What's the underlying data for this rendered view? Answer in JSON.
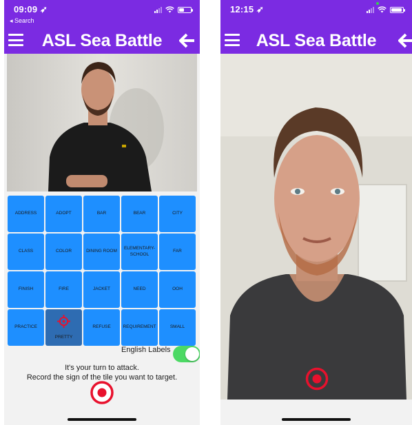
{
  "left": {
    "status": {
      "time": "09:09 ➶",
      "back_label": "◂ Search"
    },
    "nav": {
      "title": "ASL Sea Battle"
    },
    "tiles": [
      "ADDRESS",
      "ADOPT",
      "BAR",
      "BEAR",
      "CITY",
      "CLASS",
      "COLOR",
      "DINING ROOM",
      "ELEMENTARY-SCHOOL",
      "FAR",
      "FINISH",
      "FIRE",
      "JACKET",
      "NEED",
      "OOH",
      "PRACTICE",
      "PRETTY",
      "REFUSE",
      "REQUIREMENT",
      "SMALL"
    ],
    "targeted_tile": "PRETTY",
    "english_labels": {
      "label": "English Labels",
      "enabled": true
    },
    "message_line1": "It's your turn to attack.",
    "message_line2": "Record the sign of the tile you want to target."
  },
  "right": {
    "status": {
      "time": "12:15 ➶"
    },
    "nav": {
      "title": "ASL Sea Battle"
    }
  },
  "colors": {
    "purple": "#7b2be2",
    "tile_blue": "#1e8fff",
    "target_red": "#e8112d",
    "toggle_green": "#4cd964"
  },
  "icons": [
    "menu-icon",
    "back-arrow-icon",
    "crosshair-icon",
    "target-icon",
    "wifi-icon",
    "battery-icon",
    "signal-icon"
  ]
}
